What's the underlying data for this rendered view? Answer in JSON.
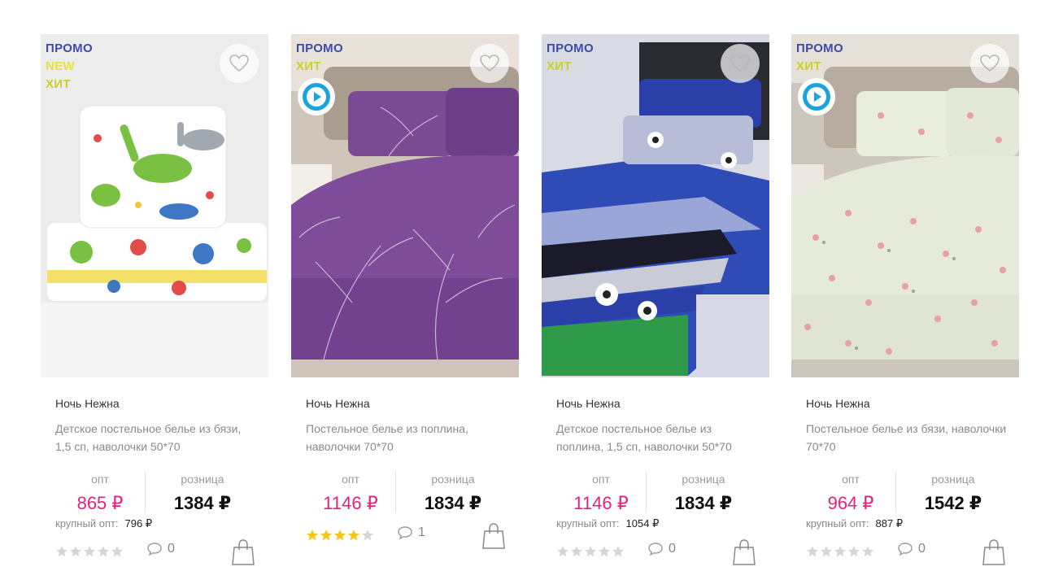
{
  "labels": {
    "opt": "опт",
    "retail": "розница",
    "bulk": "крупный опт:"
  },
  "badge_text": {
    "promo": "ПРОМО",
    "new": "NEW",
    "hit": "ХИТ"
  },
  "colors": {
    "opt_price": "#e8207a",
    "star_filled": "#f5c518",
    "star_empty": "#d6d6d6",
    "promo": "#3d4aa9",
    "play": "#1aa3e0"
  },
  "products": [
    {
      "brand": "Ночь Нежна",
      "description": "Детское постельное белье из бязи, 1,5 сп, наволочки 50*70",
      "badges": [
        "promo",
        "new",
        "hit"
      ],
      "has_video": false,
      "image": "dinosaur-pattern-bedding",
      "opt_price": "865 ₽",
      "retail_price": "1384 ₽",
      "bulk_price": "796 ₽",
      "rating": 0,
      "comments": "0"
    },
    {
      "brand": "Ночь Нежна",
      "description": "Постельное белье из поплина, наволочки 70*70",
      "badges": [
        "promo",
        "hit"
      ],
      "has_video": true,
      "image": "purple-branches-bedding",
      "opt_price": "1146 ₽",
      "retail_price": "1834 ₽",
      "bulk_price": null,
      "rating": 4,
      "comments": "1"
    },
    {
      "brand": "Ночь Нежна",
      "description": "Детское постельное белье из поплина, 1,5 сп, наволочки 50*70",
      "badges": [
        "promo",
        "hit"
      ],
      "has_video": false,
      "image": "football-blue-bedding",
      "opt_price": "1146 ₽",
      "retail_price": "1834 ₽",
      "bulk_price": "1054 ₽",
      "rating": 0,
      "comments": "0"
    },
    {
      "brand": "Ночь Нежна",
      "description": "Постельное белье из бязи, наволочки 70*70",
      "badges": [
        "promo",
        "hit"
      ],
      "has_video": true,
      "image": "pink-roses-bedding",
      "opt_price": "964 ₽",
      "retail_price": "1542 ₽",
      "bulk_price": "887 ₽",
      "rating": 0,
      "comments": "0"
    }
  ]
}
